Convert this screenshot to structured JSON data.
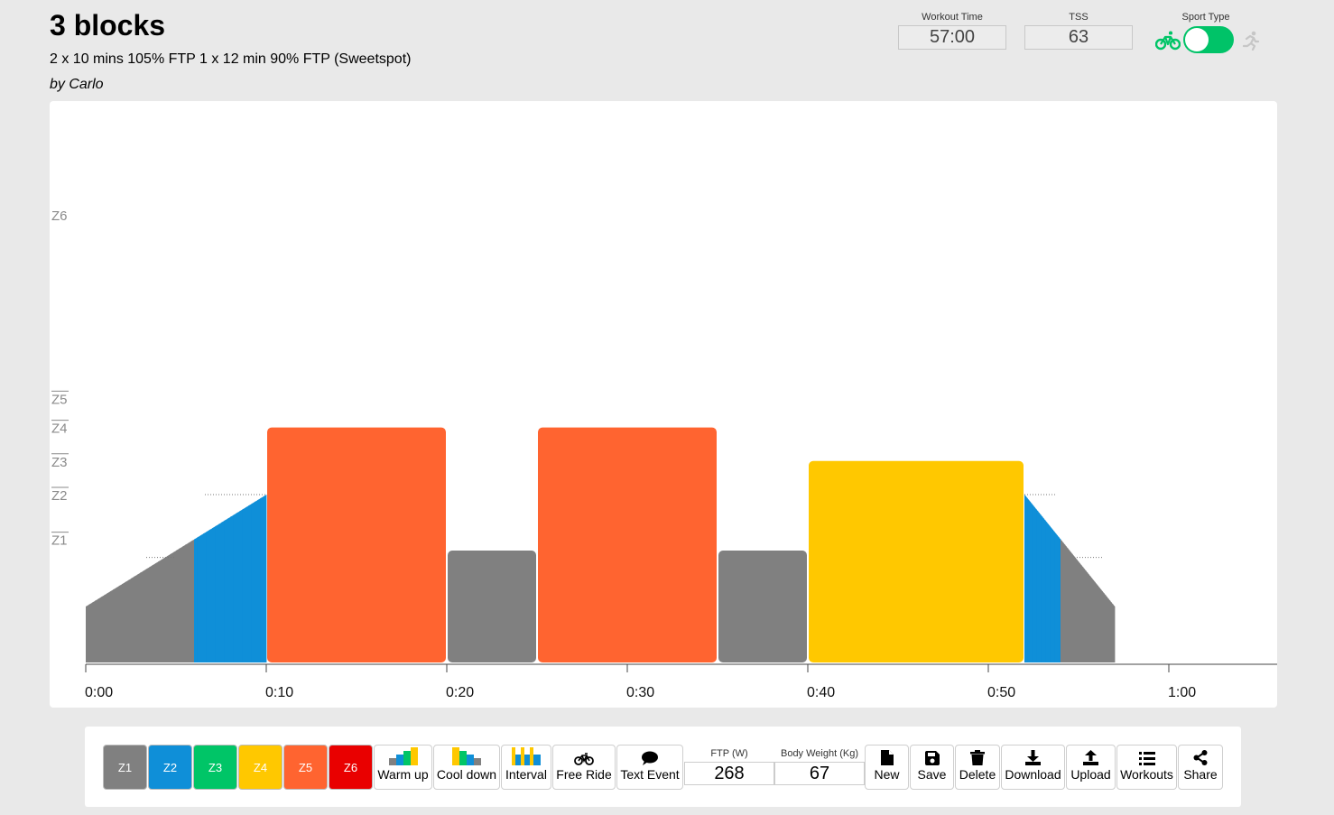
{
  "header": {
    "title": "3 blocks",
    "description": "2 x 10 mins 105% FTP 1 x 12 min 90% FTP (Sweetspot)",
    "author": "by Carlo"
  },
  "stats": {
    "workout_time_label": "Workout Time",
    "workout_time": "57:00",
    "tss_label": "TSS",
    "tss": "63",
    "sport_type_label": "Sport Type"
  },
  "chart": {
    "zone_labels": [
      "Z1",
      "Z2",
      "Z3",
      "Z4",
      "Z5",
      "Z6"
    ],
    "time_labels": [
      "0:00",
      "0:10",
      "0:20",
      "0:30",
      "0:40",
      "0:50",
      "1:00"
    ],
    "colors": {
      "z1": "#808080",
      "z2": "#0f8fd8",
      "z3": "#00c567",
      "z4": "#ffc800",
      "z5": "#ff6430",
      "z6": "#e90000"
    }
  },
  "chart_data": {
    "type": "area",
    "x_unit": "minutes",
    "y_unit": "% FTP",
    "x_ticks": [
      "0:00",
      "0:10",
      "0:20",
      "0:30",
      "0:40",
      "0:50",
      "1:00"
    ],
    "segments": [
      {
        "kind": "warmup",
        "start": 0,
        "end": 10,
        "power_start": 25,
        "power_end": 75
      },
      {
        "kind": "steady",
        "start": 10,
        "end": 20,
        "power": 105,
        "zone": "Z4"
      },
      {
        "kind": "steady",
        "start": 20,
        "end": 25,
        "power": 50,
        "zone": "Z1"
      },
      {
        "kind": "steady",
        "start": 25,
        "end": 35,
        "power": 105,
        "zone": "Z4"
      },
      {
        "kind": "steady",
        "start": 35,
        "end": 40,
        "power": 50,
        "zone": "Z1"
      },
      {
        "kind": "steady",
        "start": 40,
        "end": 52,
        "power": 90,
        "zone": "Z3"
      },
      {
        "kind": "cooldown",
        "start": 52,
        "end": 57,
        "power_start": 75,
        "power_end": 25
      }
    ]
  },
  "toolbar": {
    "zones": [
      "Z1",
      "Z2",
      "Z3",
      "Z4",
      "Z5",
      "Z6"
    ],
    "warmup": "Warm up",
    "cooldown": "Cool down",
    "interval": "Interval",
    "freeride": "Free Ride",
    "textevent": "Text Event",
    "ftp_label": "FTP (W)",
    "ftp": "268",
    "weight_label": "Body Weight (Kg)",
    "weight": "67",
    "new": "New",
    "save": "Save",
    "delete": "Delete",
    "download": "Download",
    "upload": "Upload",
    "workouts": "Workouts",
    "share": "Share"
  }
}
